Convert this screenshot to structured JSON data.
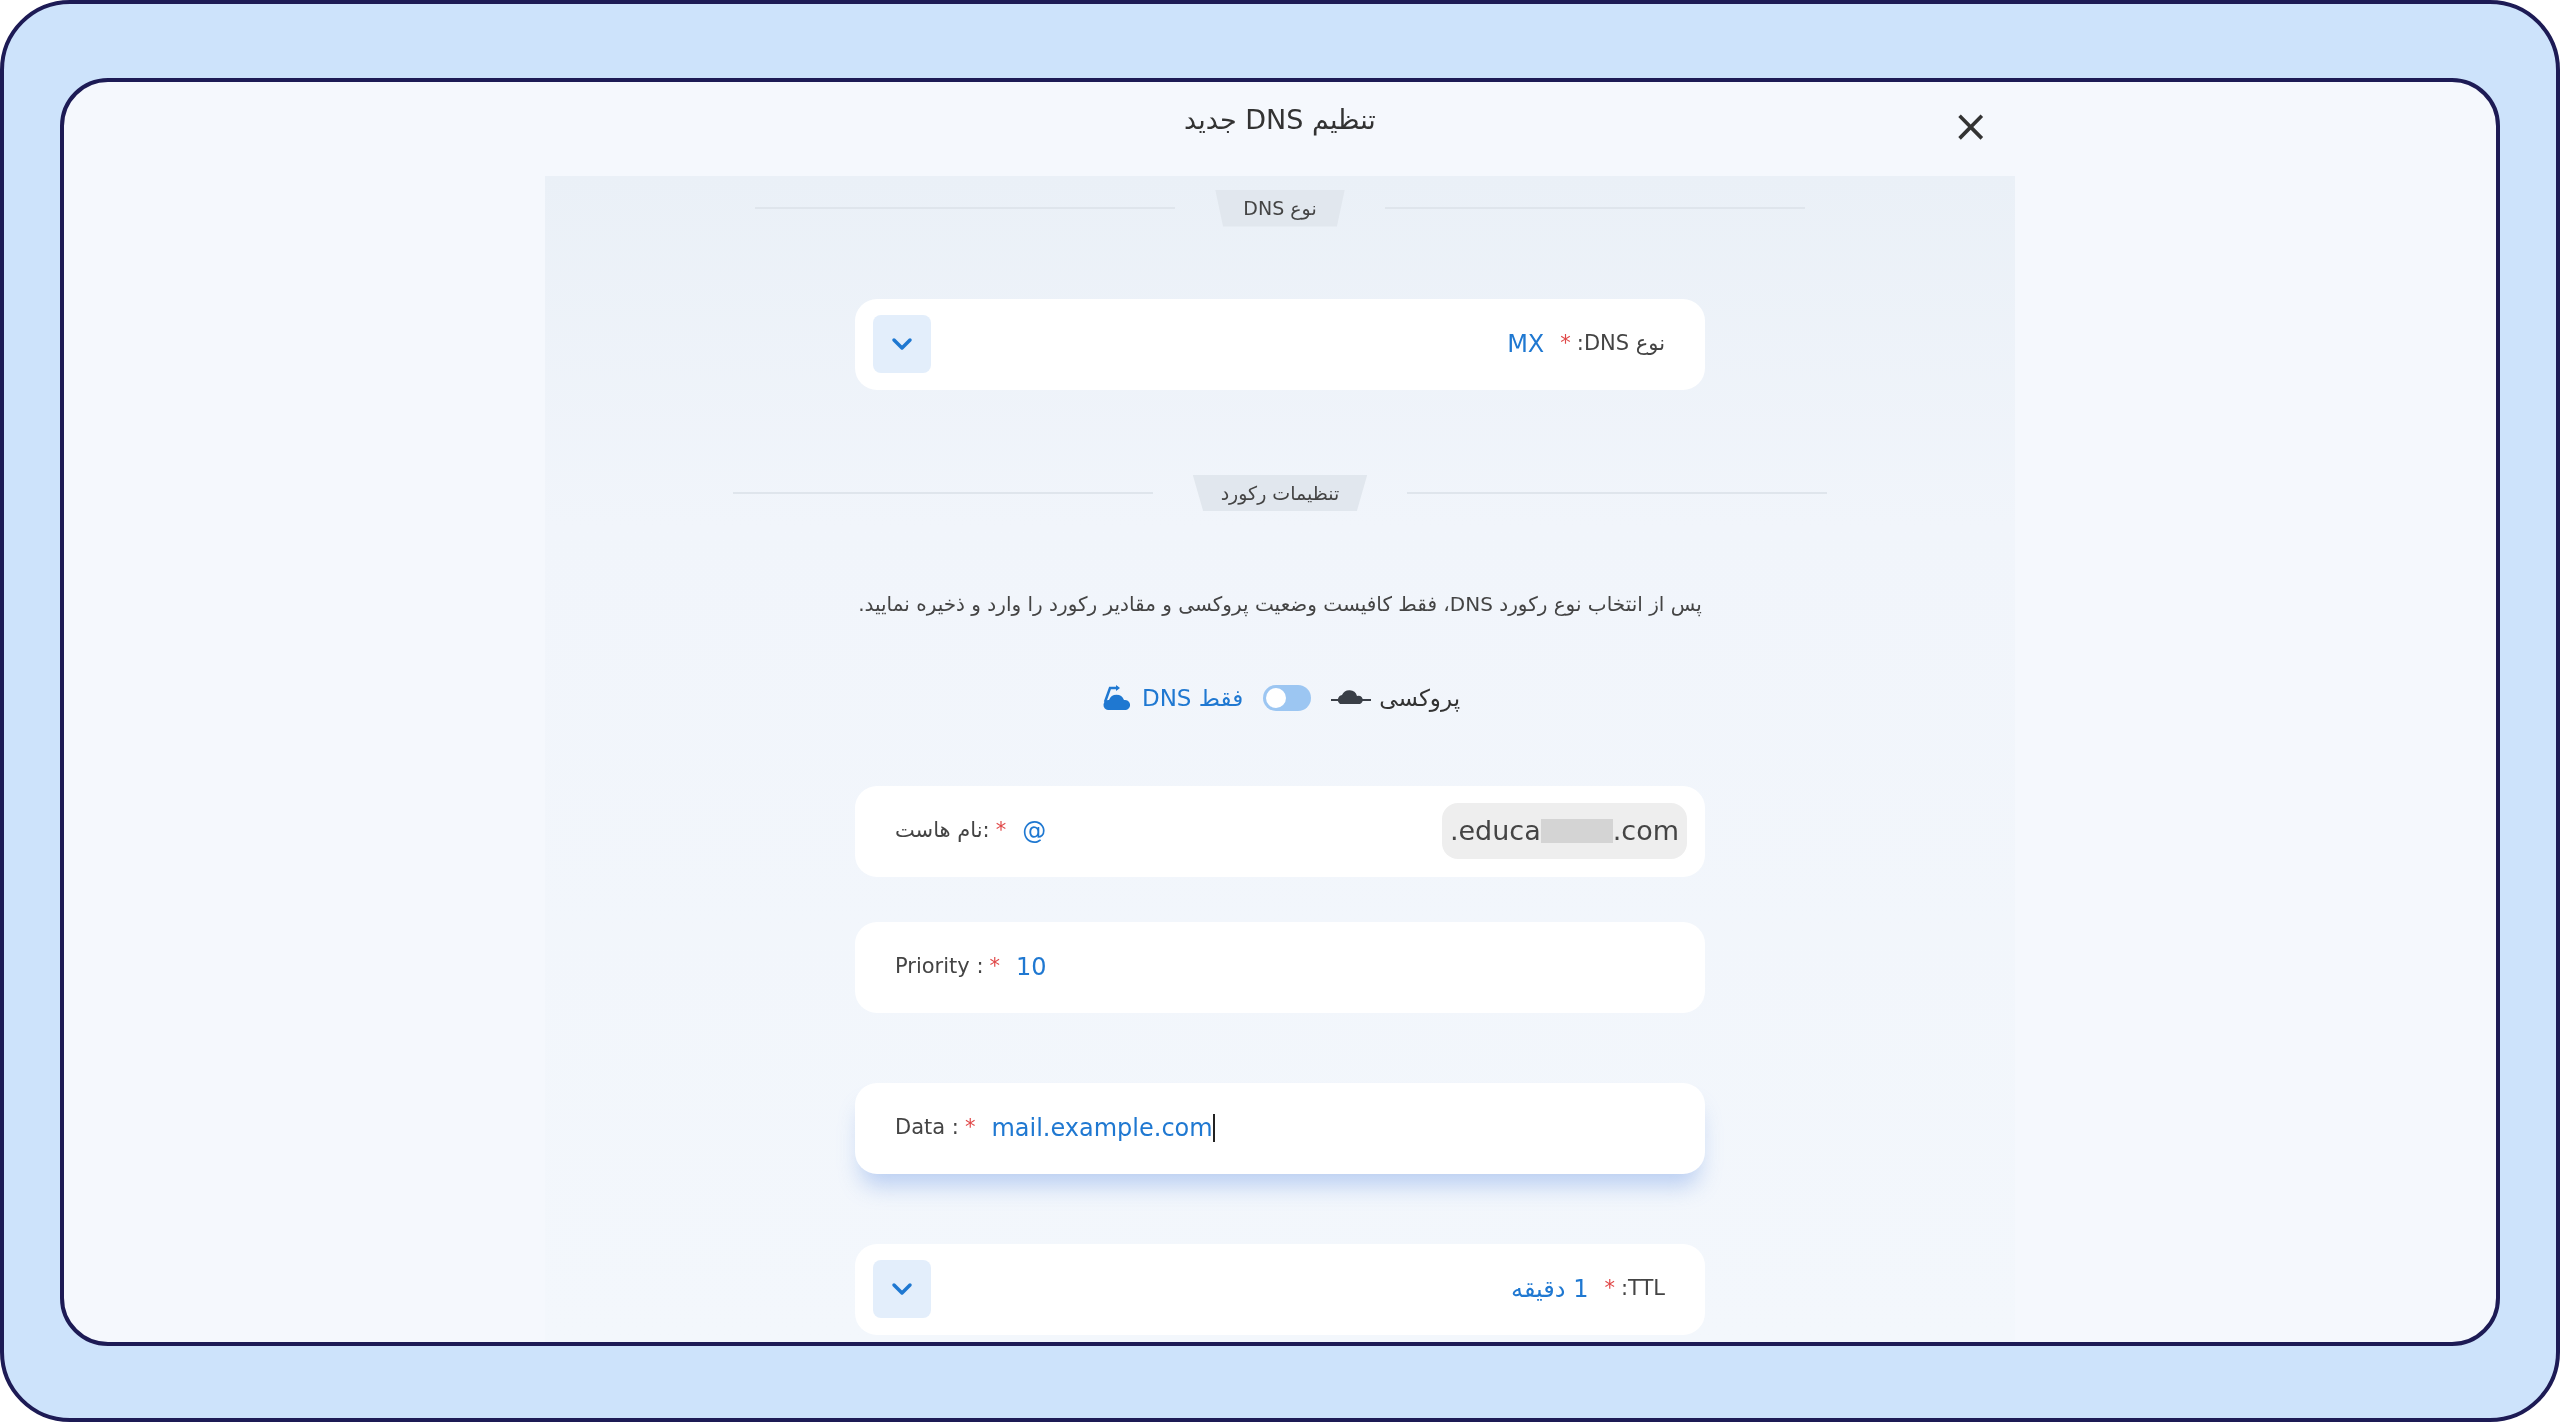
{
  "dialog": {
    "title": "تنظیم DNS جدید",
    "close": "×"
  },
  "sections": [
    {
      "heading": "نوع DNS",
      "fields": [
        {
          "kind": "select",
          "label": "نوع DNS:",
          "required_mark": "*",
          "value": "MX",
          "focused": false
        }
      ]
    },
    {
      "heading": "تنظیمات رکورد",
      "intro": "پس از انتخاب نوع رکورد DNS، فقط کافیست وضعیت پروکسی و مقادیر رکورد را وارد و ذخیره نمایید.",
      "modes": [
        {
          "kind": "proxy",
          "label": "پروکسی",
          "selected": false
        },
        {
          "kind": "dns",
          "label": "فقط DNS",
          "selected": true
        }
      ],
      "proxy_toggle": {
        "on": false
      },
      "fields": [
        {
          "kind": "host",
          "label": "نام هاست:",
          "required_mark": "*",
          "value": "@",
          "domain_start": ".educa",
          "domain_end": ".com",
          "focused": false
        },
        {
          "kind": "text",
          "label": "Priority :",
          "required_mark": "*",
          "value": "10",
          "focused": false
        },
        {
          "kind": "text",
          "label": "Data :",
          "required_mark": "*",
          "value": "mail.example.com",
          "focused": true
        },
        {
          "kind": "select",
          "label": "TTL:",
          "required_mark": "*",
          "value": "1 دقیقه",
          "focused": false
        }
      ]
    }
  ]
}
